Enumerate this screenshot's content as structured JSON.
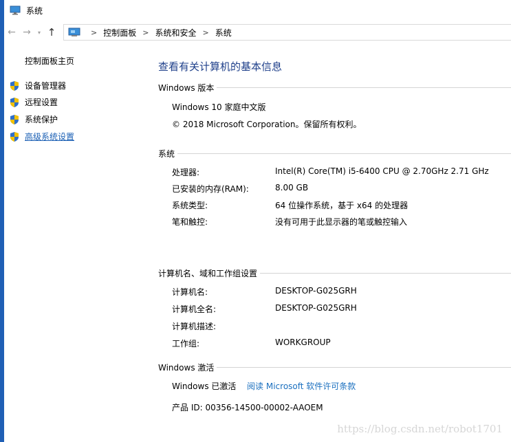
{
  "window": {
    "title": "系统"
  },
  "address": {
    "crumbs": [
      "控制面板",
      "系统和安全",
      "系统"
    ]
  },
  "sidebar": {
    "home": "控制面板主页",
    "items": [
      {
        "label": "设备管理器"
      },
      {
        "label": "远程设置"
      },
      {
        "label": "系统保护"
      },
      {
        "label": "高级系统设置"
      }
    ]
  },
  "main": {
    "title": "查看有关计算机的基本信息",
    "edition": {
      "heading": "Windows 版本",
      "name": "Windows 10 家庭中文版",
      "copyright": "© 2018 Microsoft Corporation。保留所有权利。"
    },
    "system": {
      "heading": "系统",
      "rows": [
        {
          "k": "处理器:",
          "v": "Intel(R) Core(TM) i5-6400 CPU @ 2.70GHz   2.71 GHz"
        },
        {
          "k": "已安装的内存(RAM):",
          "v": "8.00 GB"
        },
        {
          "k": "系统类型:",
          "v": "64 位操作系统，基于 x64 的处理器"
        },
        {
          "k": "笔和触控:",
          "v": "没有可用于此显示器的笔或触控输入"
        }
      ]
    },
    "computer": {
      "heading": "计算机名、域和工作组设置",
      "rows": [
        {
          "k": "计算机名:",
          "v": "DESKTOP-G025GRH"
        },
        {
          "k": "计算机全名:",
          "v": "DESKTOP-G025GRH"
        },
        {
          "k": "计算机描述:",
          "v": ""
        },
        {
          "k": "工作组:",
          "v": "WORKGROUP"
        }
      ]
    },
    "activation": {
      "heading": "Windows 激活",
      "status": "Windows 已激活",
      "license_link": "阅读 Microsoft 软件许可条款",
      "product_id": "产品 ID: 00356-14500-00002-AAOEM"
    }
  },
  "watermark": "https://blog.csdn.net/robot1701",
  "colors": {
    "accent": "#1f5fb5",
    "title": "#1e3f8a",
    "link": "#1a6fbf"
  }
}
